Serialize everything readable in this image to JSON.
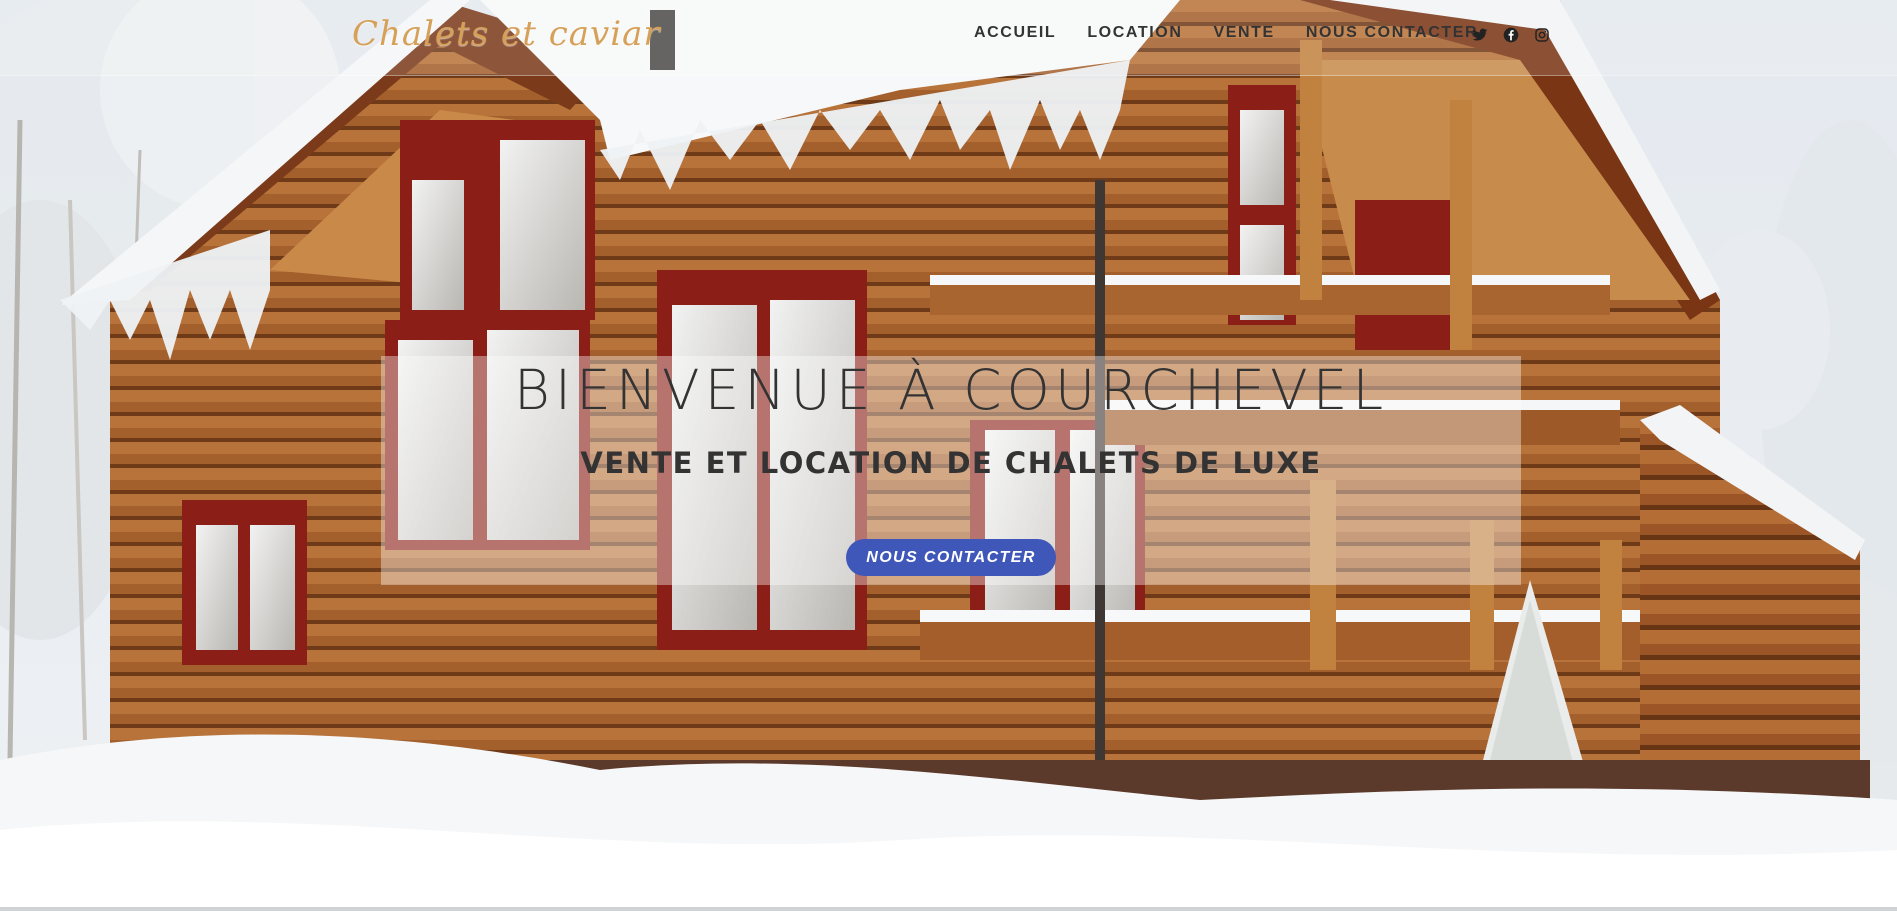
{
  "header": {
    "logo_text": "Chalets et caviar",
    "nav": [
      {
        "label": "ACCUEIL"
      },
      {
        "label": "LOCATION"
      },
      {
        "label": "VENTE"
      },
      {
        "label": "NOUS CONTACTER"
      }
    ],
    "social_icons": [
      "twitter-icon",
      "facebook-icon",
      "instagram-icon"
    ]
  },
  "hero": {
    "title": "BIENVENUE À COURCHEVEL",
    "subtitle": "VENTE ET LOCATION DE CHALETS DE LUXE",
    "cta_label": "NOUS CONTACTER"
  },
  "colors": {
    "accent": "#3f57b8",
    "logo": "#d6a059",
    "text": "#333333",
    "wood": "#9c5a2a",
    "window_frame": "#8e1f1a",
    "snow": "#f7f8f9"
  }
}
